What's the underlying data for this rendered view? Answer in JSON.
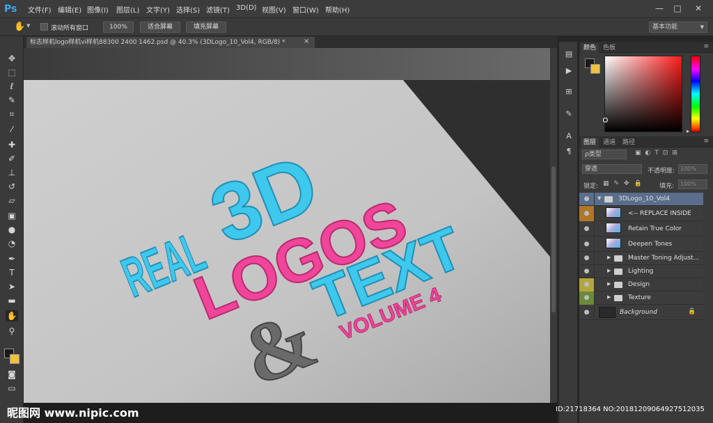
{
  "app": {
    "logo": "Ps"
  },
  "menu": [
    "文件(F)",
    "编辑(E)",
    "图像(I)",
    "图层(L)",
    "文字(Y)",
    "选择(S)",
    "滤镜(T)",
    "3D(D)",
    "视图(V)",
    "窗口(W)",
    "帮助(H)"
  ],
  "window_controls": {
    "minimize": "—",
    "maximize": "□",
    "close": "✕"
  },
  "options": {
    "scroll_all_label": "滚动所有窗口",
    "zoom_100": "100%",
    "fit_screen": "适合屏幕",
    "fill_screen": "填充屏幕",
    "workspace": "基本功能"
  },
  "document": {
    "tab_title": "标志样机logo样机vi样机88300 2400 1462.psd @ 40.3% (3DLogo_10_Vol4, RGB/8) *",
    "close": "×",
    "art": {
      "line1": "REAL",
      "line2": "3D",
      "line3": "LOGOS",
      "line4": "TEXT",
      "amp": "&",
      "line5": "VOLUME 4"
    }
  },
  "color_panel": {
    "tabs": [
      "颜色",
      "色板"
    ],
    "fg_color": "#1a1a1a",
    "bg_color": "#f0c23c"
  },
  "layers_panel": {
    "tabs": [
      "图层",
      "通道",
      "路径"
    ],
    "filter_label": "ρ类型",
    "blend_mode": "穿透",
    "opacity_label": "不透明度:",
    "opacity_value": "100%",
    "lock_label": "锁定:",
    "fill_label": "填充:",
    "fill_value": "100%",
    "layers": [
      {
        "name": "3DLogo_10_Vol4",
        "kind": "group-open"
      },
      {
        "name": "<-- REPLACE INSIDE",
        "kind": "smart"
      },
      {
        "name": "Retain True Color",
        "kind": "smart"
      },
      {
        "name": "Deepen Tones",
        "kind": "smart"
      },
      {
        "name": "Master Toning Adjust...",
        "kind": "group"
      },
      {
        "name": "Lighting",
        "kind": "group"
      },
      {
        "name": "Design",
        "kind": "group"
      },
      {
        "name": "Texture",
        "kind": "group"
      },
      {
        "name": "Background",
        "kind": "background"
      }
    ]
  },
  "watermark": {
    "left": "昵图网 www.nipic.com",
    "right": "ID:21718364 NO:20181209064927512035"
  },
  "colors": {
    "cyan": "#3ec8ee",
    "pink": "#f0459a",
    "paper": "#d2d2d2"
  }
}
